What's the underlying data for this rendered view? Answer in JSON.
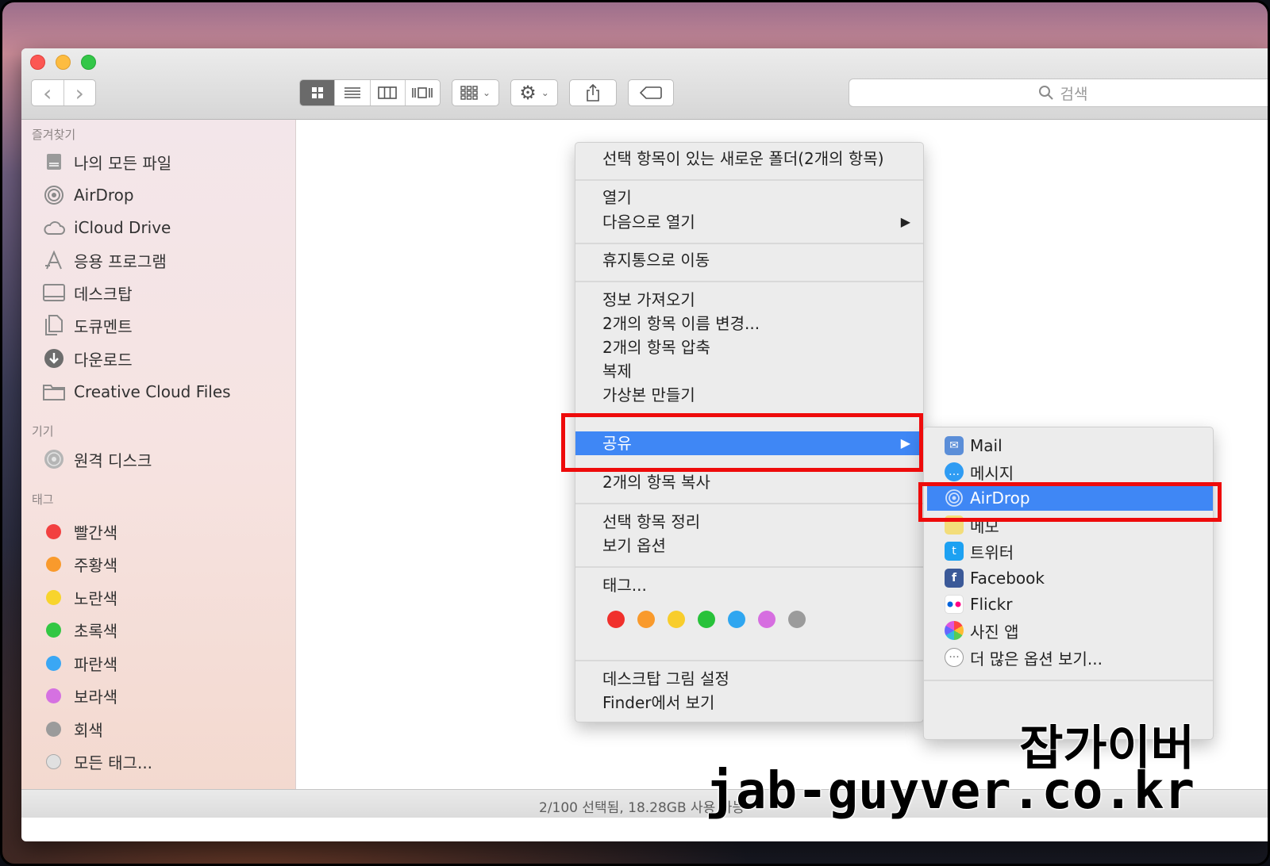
{
  "toolbar": {
    "back_glyph": "‹",
    "forward_glyph": "›",
    "search_placeholder": "검색"
  },
  "sidebar": {
    "favorites_header": "즐겨찾기",
    "favorites": [
      {
        "label": "나의 모든 파일",
        "icon": "all-files-icon"
      },
      {
        "label": "AirDrop",
        "icon": "airdrop-icon"
      },
      {
        "label": "iCloud Drive",
        "icon": "cloud-icon"
      },
      {
        "label": "응용 프로그램",
        "icon": "applications-icon"
      },
      {
        "label": "데스크탑",
        "icon": "desktop-icon"
      },
      {
        "label": "도큐멘트",
        "icon": "documents-icon"
      },
      {
        "label": "다운로드",
        "icon": "download-icon"
      },
      {
        "label": "Creative Cloud Files",
        "icon": "folder-icon"
      }
    ],
    "devices_header": "기기",
    "devices": [
      {
        "label": "원격 디스크",
        "icon": "disc-icon"
      }
    ],
    "tags_header": "태그",
    "tags": [
      {
        "label": "빨간색",
        "color": "#f24040"
      },
      {
        "label": "주황색",
        "color": "#f99a2c"
      },
      {
        "label": "노란색",
        "color": "#f8d42c"
      },
      {
        "label": "초록색",
        "color": "#32c743"
      },
      {
        "label": "파란색",
        "color": "#3aa7f4"
      },
      {
        "label": "보라색",
        "color": "#d571e1"
      },
      {
        "label": "회색",
        "color": "#9b9b9b"
      },
      {
        "label": "모든 태그...",
        "color": "#e0e0e0"
      }
    ]
  },
  "status": "2/100 선택됨, 18.28GB 사용 가능",
  "context_menu": {
    "new_folder": "선택 항목이 있는 새로운 폴더(2개의 항목)",
    "open": "열기",
    "open_with": "다음으로 열기",
    "trash": "휴지통으로 이동",
    "get_info": "정보 가져오기",
    "rename": "2개의 항목 이름 변경...",
    "compress": "2개의 항목 압축",
    "duplicate": "복제",
    "make_alias": "가상본 만들기",
    "share": "공유",
    "copy": "2개의 항목 복사",
    "cleanup": "선택 항목 정리",
    "view_options": "보기 옵션",
    "tags": "태그...",
    "tag_colors": [
      "#f0302c",
      "#f99a2c",
      "#f8cd2c",
      "#28c23a",
      "#2fa6f0",
      "#d66ee0",
      "#9b9b9b"
    ],
    "desktop_picture": "데스크탑 그림 설정",
    "show_in_finder": "Finder에서 보기",
    "submenu_arrow": "▶"
  },
  "share_menu": {
    "items": [
      {
        "label": "Mail",
        "icon": "mail-icon"
      },
      {
        "label": "메시지",
        "icon": "messages-icon"
      },
      {
        "label": "AirDrop",
        "icon": "airdrop-icon"
      },
      {
        "label": "메모",
        "icon": "notes-icon"
      },
      {
        "label": "트위터",
        "icon": "twitter-icon"
      },
      {
        "label": "Facebook",
        "icon": "facebook-icon"
      },
      {
        "label": "Flickr",
        "icon": "flickr-icon"
      },
      {
        "label": "사진 앱",
        "icon": "photos-icon"
      },
      {
        "label": "더 많은 옵션 보기...",
        "icon": "more-icon"
      }
    ]
  },
  "watermark": {
    "title": "잡가이버",
    "url": "jab-guyver.co.kr"
  }
}
